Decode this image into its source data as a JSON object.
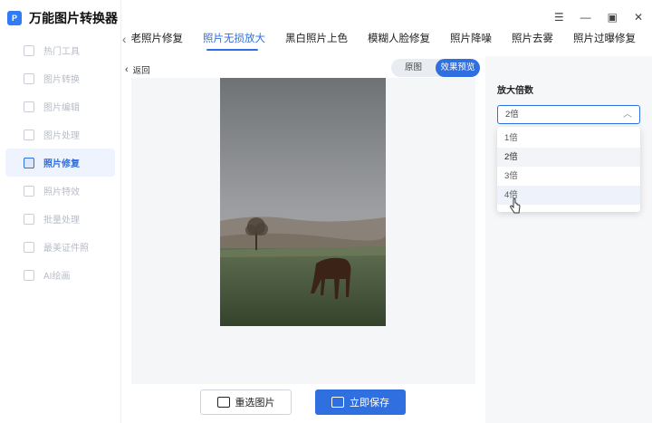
{
  "app": {
    "logo_text": "P",
    "title": "万能图片转换器"
  },
  "sidebar": {
    "items": [
      {
        "label": "热门工具",
        "icon": "fire-icon",
        "active": false
      },
      {
        "label": "图片转换",
        "icon": "convert-icon",
        "active": false
      },
      {
        "label": "图片编辑",
        "icon": "edit-icon",
        "active": false
      },
      {
        "label": "图片处理",
        "icon": "process-icon",
        "active": false
      },
      {
        "label": "照片修复",
        "icon": "repair-icon",
        "active": true
      },
      {
        "label": "照片特效",
        "icon": "effects-icon",
        "active": false
      },
      {
        "label": "批量处理",
        "icon": "batch-icon",
        "active": false
      },
      {
        "label": "最美证件照",
        "icon": "id-photo-icon",
        "active": false
      },
      {
        "label": "AI绘画",
        "icon": "ai-paint-icon",
        "active": false
      }
    ]
  },
  "window_controls": {
    "menu": "☰",
    "minimize": "—",
    "maximize": "▣",
    "close": "✕"
  },
  "tabs": {
    "prev_arrow": "‹",
    "items": [
      {
        "label": "老照片修复",
        "active": false
      },
      {
        "label": "照片无损放大",
        "active": true
      },
      {
        "label": "黑白照片上色",
        "active": false
      },
      {
        "label": "模糊人脸修复",
        "active": false
      },
      {
        "label": "照片降噪",
        "active": false
      },
      {
        "label": "照片去雾",
        "active": false
      },
      {
        "label": "照片过曝修复",
        "active": false
      }
    ]
  },
  "workspace": {
    "back_label": "返回",
    "toggle": {
      "original": "原图",
      "preview": "效果预览",
      "active": "preview"
    },
    "reselect_button": "重选图片",
    "save_button": "立即保存"
  },
  "panel": {
    "title": "放大倍数",
    "select_value": "2倍",
    "options": [
      "1倍",
      "2倍",
      "3倍",
      "4倍"
    ],
    "selected_option": "2倍",
    "hovered_option": "4倍"
  },
  "colors": {
    "accent": "#2f6fe0",
    "sidebar_active_bg": "#eef3fd",
    "panel_bg": "#f6f7f9"
  }
}
